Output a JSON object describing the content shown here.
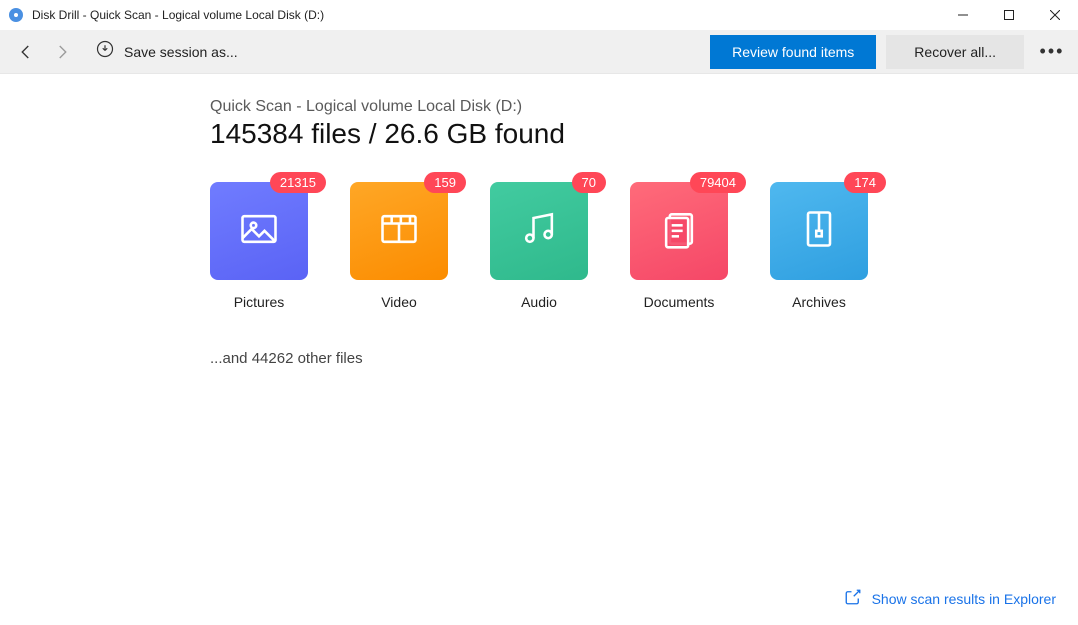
{
  "window": {
    "title": "Disk Drill - Quick Scan - Logical volume Local Disk (D:)"
  },
  "toolbar": {
    "save_session_label": "Save session as...",
    "review_button": "Review found items",
    "recover_button": "Recover all..."
  },
  "scan": {
    "subtitle": "Quick Scan - Logical volume Local Disk (D:)",
    "headline": "145384 files / 26.6 GB found",
    "other_files": "...and 44262 other files"
  },
  "categories": [
    {
      "name": "Pictures",
      "count": "21315"
    },
    {
      "name": "Video",
      "count": "159"
    },
    {
      "name": "Audio",
      "count": "70"
    },
    {
      "name": "Documents",
      "count": "79404"
    },
    {
      "name": "Archives",
      "count": "174"
    }
  ],
  "footer": {
    "show_in_explorer": "Show scan results in Explorer"
  }
}
